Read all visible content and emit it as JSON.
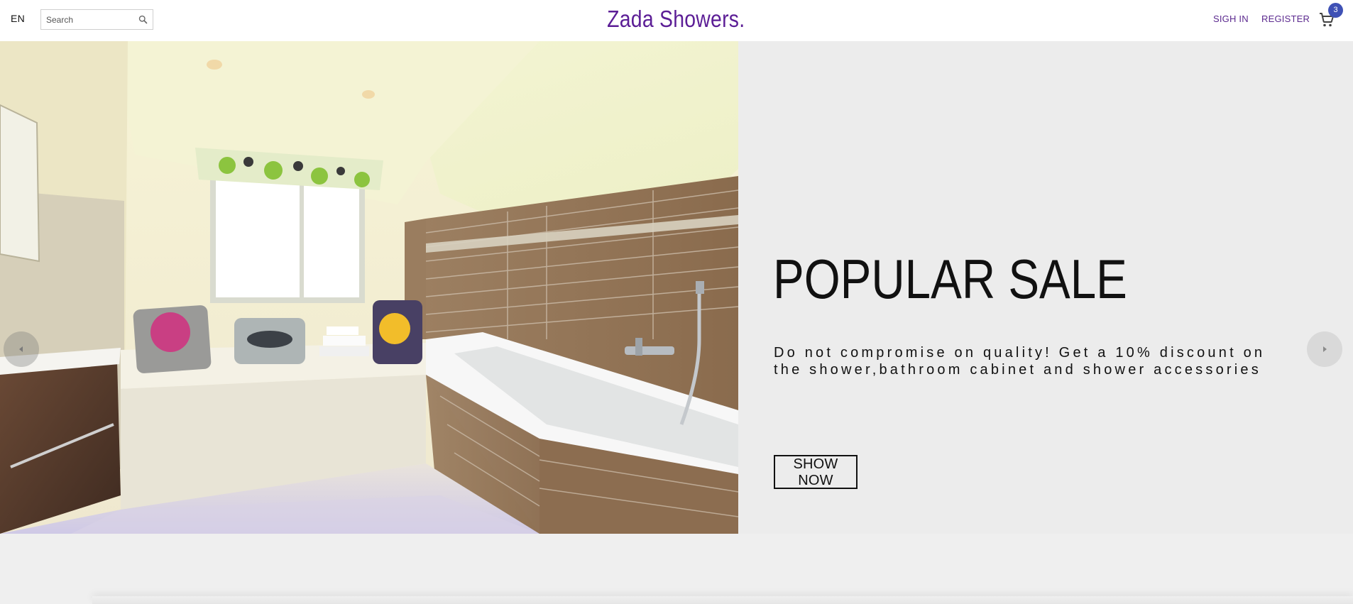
{
  "header": {
    "language": "EN",
    "search": {
      "placeholder": "Search",
      "value": ""
    },
    "logo": "Zada Showers.",
    "nav": {
      "sign_in": "SIGH IN",
      "register": "REGISTER"
    },
    "cart": {
      "count": "3",
      "icon": "cart-icon"
    },
    "colors": {
      "logo": "#5c1e96",
      "nav": "#5c2a8f",
      "badge": "#3f51b5"
    }
  },
  "hero": {
    "title": "POPULAR SALE",
    "text": "Do not compromise on quality! Get a 10% discount on the shower,bathroom cabinet and shower accessories",
    "button": "SHOW NOW",
    "image_alt": "bathroom-photo",
    "prev_icon": "chevron-left-icon",
    "next_icon": "chevron-right-icon",
    "background": "#ececec"
  }
}
